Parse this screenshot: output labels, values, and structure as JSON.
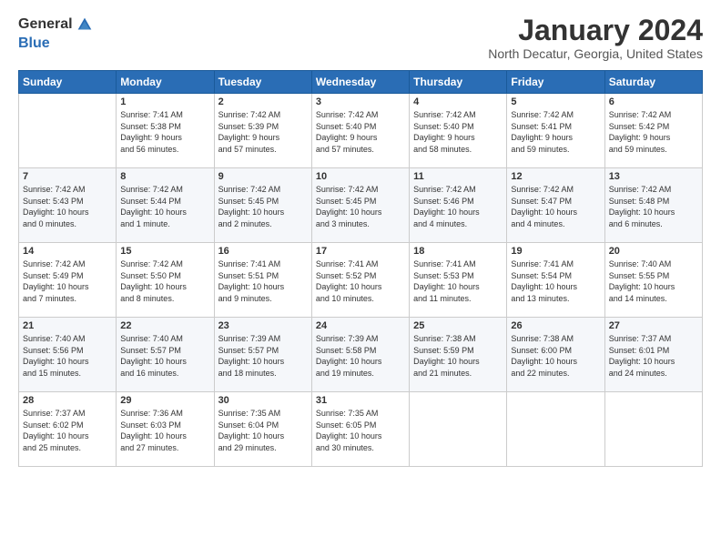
{
  "header": {
    "logo_general": "General",
    "logo_blue": "Blue",
    "month_title": "January 2024",
    "location": "North Decatur, Georgia, United States"
  },
  "days_of_week": [
    "Sunday",
    "Monday",
    "Tuesday",
    "Wednesday",
    "Thursday",
    "Friday",
    "Saturday"
  ],
  "weeks": [
    [
      {
        "day": "",
        "info": ""
      },
      {
        "day": "1",
        "info": "Sunrise: 7:41 AM\nSunset: 5:38 PM\nDaylight: 9 hours\nand 56 minutes."
      },
      {
        "day": "2",
        "info": "Sunrise: 7:42 AM\nSunset: 5:39 PM\nDaylight: 9 hours\nand 57 minutes."
      },
      {
        "day": "3",
        "info": "Sunrise: 7:42 AM\nSunset: 5:40 PM\nDaylight: 9 hours\nand 57 minutes."
      },
      {
        "day": "4",
        "info": "Sunrise: 7:42 AM\nSunset: 5:40 PM\nDaylight: 9 hours\nand 58 minutes."
      },
      {
        "day": "5",
        "info": "Sunrise: 7:42 AM\nSunset: 5:41 PM\nDaylight: 9 hours\nand 59 minutes."
      },
      {
        "day": "6",
        "info": "Sunrise: 7:42 AM\nSunset: 5:42 PM\nDaylight: 9 hours\nand 59 minutes."
      }
    ],
    [
      {
        "day": "7",
        "info": "Sunrise: 7:42 AM\nSunset: 5:43 PM\nDaylight: 10 hours\nand 0 minutes."
      },
      {
        "day": "8",
        "info": "Sunrise: 7:42 AM\nSunset: 5:44 PM\nDaylight: 10 hours\nand 1 minute."
      },
      {
        "day": "9",
        "info": "Sunrise: 7:42 AM\nSunset: 5:45 PM\nDaylight: 10 hours\nand 2 minutes."
      },
      {
        "day": "10",
        "info": "Sunrise: 7:42 AM\nSunset: 5:45 PM\nDaylight: 10 hours\nand 3 minutes."
      },
      {
        "day": "11",
        "info": "Sunrise: 7:42 AM\nSunset: 5:46 PM\nDaylight: 10 hours\nand 4 minutes."
      },
      {
        "day": "12",
        "info": "Sunrise: 7:42 AM\nSunset: 5:47 PM\nDaylight: 10 hours\nand 4 minutes."
      },
      {
        "day": "13",
        "info": "Sunrise: 7:42 AM\nSunset: 5:48 PM\nDaylight: 10 hours\nand 6 minutes."
      }
    ],
    [
      {
        "day": "14",
        "info": "Sunrise: 7:42 AM\nSunset: 5:49 PM\nDaylight: 10 hours\nand 7 minutes."
      },
      {
        "day": "15",
        "info": "Sunrise: 7:42 AM\nSunset: 5:50 PM\nDaylight: 10 hours\nand 8 minutes."
      },
      {
        "day": "16",
        "info": "Sunrise: 7:41 AM\nSunset: 5:51 PM\nDaylight: 10 hours\nand 9 minutes."
      },
      {
        "day": "17",
        "info": "Sunrise: 7:41 AM\nSunset: 5:52 PM\nDaylight: 10 hours\nand 10 minutes."
      },
      {
        "day": "18",
        "info": "Sunrise: 7:41 AM\nSunset: 5:53 PM\nDaylight: 10 hours\nand 11 minutes."
      },
      {
        "day": "19",
        "info": "Sunrise: 7:41 AM\nSunset: 5:54 PM\nDaylight: 10 hours\nand 13 minutes."
      },
      {
        "day": "20",
        "info": "Sunrise: 7:40 AM\nSunset: 5:55 PM\nDaylight: 10 hours\nand 14 minutes."
      }
    ],
    [
      {
        "day": "21",
        "info": "Sunrise: 7:40 AM\nSunset: 5:56 PM\nDaylight: 10 hours\nand 15 minutes."
      },
      {
        "day": "22",
        "info": "Sunrise: 7:40 AM\nSunset: 5:57 PM\nDaylight: 10 hours\nand 16 minutes."
      },
      {
        "day": "23",
        "info": "Sunrise: 7:39 AM\nSunset: 5:57 PM\nDaylight: 10 hours\nand 18 minutes."
      },
      {
        "day": "24",
        "info": "Sunrise: 7:39 AM\nSunset: 5:58 PM\nDaylight: 10 hours\nand 19 minutes."
      },
      {
        "day": "25",
        "info": "Sunrise: 7:38 AM\nSunset: 5:59 PM\nDaylight: 10 hours\nand 21 minutes."
      },
      {
        "day": "26",
        "info": "Sunrise: 7:38 AM\nSunset: 6:00 PM\nDaylight: 10 hours\nand 22 minutes."
      },
      {
        "day": "27",
        "info": "Sunrise: 7:37 AM\nSunset: 6:01 PM\nDaylight: 10 hours\nand 24 minutes."
      }
    ],
    [
      {
        "day": "28",
        "info": "Sunrise: 7:37 AM\nSunset: 6:02 PM\nDaylight: 10 hours\nand 25 minutes."
      },
      {
        "day": "29",
        "info": "Sunrise: 7:36 AM\nSunset: 6:03 PM\nDaylight: 10 hours\nand 27 minutes."
      },
      {
        "day": "30",
        "info": "Sunrise: 7:35 AM\nSunset: 6:04 PM\nDaylight: 10 hours\nand 29 minutes."
      },
      {
        "day": "31",
        "info": "Sunrise: 7:35 AM\nSunset: 6:05 PM\nDaylight: 10 hours\nand 30 minutes."
      },
      {
        "day": "",
        "info": ""
      },
      {
        "day": "",
        "info": ""
      },
      {
        "day": "",
        "info": ""
      }
    ]
  ]
}
